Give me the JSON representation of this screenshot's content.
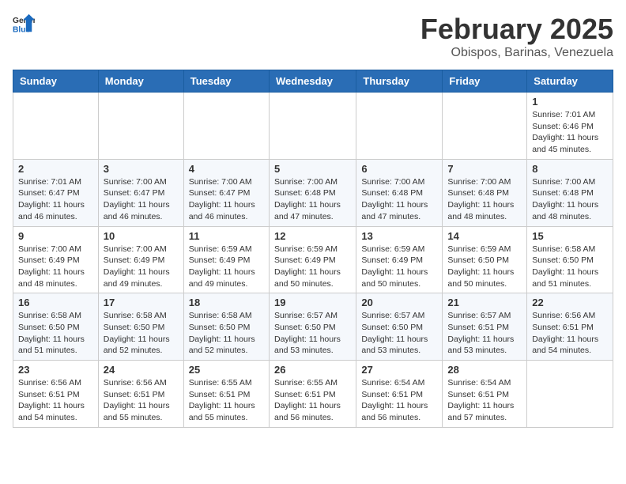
{
  "logo": {
    "general": "General",
    "blue": "Blue"
  },
  "header": {
    "month": "February 2025",
    "location": "Obispos, Barinas, Venezuela"
  },
  "weekdays": [
    "Sunday",
    "Monday",
    "Tuesday",
    "Wednesday",
    "Thursday",
    "Friday",
    "Saturday"
  ],
  "weeks": [
    [
      {
        "day": "",
        "sunrise": "",
        "sunset": "",
        "daylight": ""
      },
      {
        "day": "",
        "sunrise": "",
        "sunset": "",
        "daylight": ""
      },
      {
        "day": "",
        "sunrise": "",
        "sunset": "",
        "daylight": ""
      },
      {
        "day": "",
        "sunrise": "",
        "sunset": "",
        "daylight": ""
      },
      {
        "day": "",
        "sunrise": "",
        "sunset": "",
        "daylight": ""
      },
      {
        "day": "",
        "sunrise": "",
        "sunset": "",
        "daylight": ""
      },
      {
        "day": "1",
        "sunrise": "Sunrise: 7:01 AM",
        "sunset": "Sunset: 6:46 PM",
        "daylight": "Daylight: 11 hours and 45 minutes."
      }
    ],
    [
      {
        "day": "2",
        "sunrise": "Sunrise: 7:01 AM",
        "sunset": "Sunset: 6:47 PM",
        "daylight": "Daylight: 11 hours and 46 minutes."
      },
      {
        "day": "3",
        "sunrise": "Sunrise: 7:00 AM",
        "sunset": "Sunset: 6:47 PM",
        "daylight": "Daylight: 11 hours and 46 minutes."
      },
      {
        "day": "4",
        "sunrise": "Sunrise: 7:00 AM",
        "sunset": "Sunset: 6:47 PM",
        "daylight": "Daylight: 11 hours and 46 minutes."
      },
      {
        "day": "5",
        "sunrise": "Sunrise: 7:00 AM",
        "sunset": "Sunset: 6:48 PM",
        "daylight": "Daylight: 11 hours and 47 minutes."
      },
      {
        "day": "6",
        "sunrise": "Sunrise: 7:00 AM",
        "sunset": "Sunset: 6:48 PM",
        "daylight": "Daylight: 11 hours and 47 minutes."
      },
      {
        "day": "7",
        "sunrise": "Sunrise: 7:00 AM",
        "sunset": "Sunset: 6:48 PM",
        "daylight": "Daylight: 11 hours and 48 minutes."
      },
      {
        "day": "8",
        "sunrise": "Sunrise: 7:00 AM",
        "sunset": "Sunset: 6:48 PM",
        "daylight": "Daylight: 11 hours and 48 minutes."
      }
    ],
    [
      {
        "day": "9",
        "sunrise": "Sunrise: 7:00 AM",
        "sunset": "Sunset: 6:49 PM",
        "daylight": "Daylight: 11 hours and 48 minutes."
      },
      {
        "day": "10",
        "sunrise": "Sunrise: 7:00 AM",
        "sunset": "Sunset: 6:49 PM",
        "daylight": "Daylight: 11 hours and 49 minutes."
      },
      {
        "day": "11",
        "sunrise": "Sunrise: 6:59 AM",
        "sunset": "Sunset: 6:49 PM",
        "daylight": "Daylight: 11 hours and 49 minutes."
      },
      {
        "day": "12",
        "sunrise": "Sunrise: 6:59 AM",
        "sunset": "Sunset: 6:49 PM",
        "daylight": "Daylight: 11 hours and 50 minutes."
      },
      {
        "day": "13",
        "sunrise": "Sunrise: 6:59 AM",
        "sunset": "Sunset: 6:49 PM",
        "daylight": "Daylight: 11 hours and 50 minutes."
      },
      {
        "day": "14",
        "sunrise": "Sunrise: 6:59 AM",
        "sunset": "Sunset: 6:50 PM",
        "daylight": "Daylight: 11 hours and 50 minutes."
      },
      {
        "day": "15",
        "sunrise": "Sunrise: 6:58 AM",
        "sunset": "Sunset: 6:50 PM",
        "daylight": "Daylight: 11 hours and 51 minutes."
      }
    ],
    [
      {
        "day": "16",
        "sunrise": "Sunrise: 6:58 AM",
        "sunset": "Sunset: 6:50 PM",
        "daylight": "Daylight: 11 hours and 51 minutes."
      },
      {
        "day": "17",
        "sunrise": "Sunrise: 6:58 AM",
        "sunset": "Sunset: 6:50 PM",
        "daylight": "Daylight: 11 hours and 52 minutes."
      },
      {
        "day": "18",
        "sunrise": "Sunrise: 6:58 AM",
        "sunset": "Sunset: 6:50 PM",
        "daylight": "Daylight: 11 hours and 52 minutes."
      },
      {
        "day": "19",
        "sunrise": "Sunrise: 6:57 AM",
        "sunset": "Sunset: 6:50 PM",
        "daylight": "Daylight: 11 hours and 53 minutes."
      },
      {
        "day": "20",
        "sunrise": "Sunrise: 6:57 AM",
        "sunset": "Sunset: 6:50 PM",
        "daylight": "Daylight: 11 hours and 53 minutes."
      },
      {
        "day": "21",
        "sunrise": "Sunrise: 6:57 AM",
        "sunset": "Sunset: 6:51 PM",
        "daylight": "Daylight: 11 hours and 53 minutes."
      },
      {
        "day": "22",
        "sunrise": "Sunrise: 6:56 AM",
        "sunset": "Sunset: 6:51 PM",
        "daylight": "Daylight: 11 hours and 54 minutes."
      }
    ],
    [
      {
        "day": "23",
        "sunrise": "Sunrise: 6:56 AM",
        "sunset": "Sunset: 6:51 PM",
        "daylight": "Daylight: 11 hours and 54 minutes."
      },
      {
        "day": "24",
        "sunrise": "Sunrise: 6:56 AM",
        "sunset": "Sunset: 6:51 PM",
        "daylight": "Daylight: 11 hours and 55 minutes."
      },
      {
        "day": "25",
        "sunrise": "Sunrise: 6:55 AM",
        "sunset": "Sunset: 6:51 PM",
        "daylight": "Daylight: 11 hours and 55 minutes."
      },
      {
        "day": "26",
        "sunrise": "Sunrise: 6:55 AM",
        "sunset": "Sunset: 6:51 PM",
        "daylight": "Daylight: 11 hours and 56 minutes."
      },
      {
        "day": "27",
        "sunrise": "Sunrise: 6:54 AM",
        "sunset": "Sunset: 6:51 PM",
        "daylight": "Daylight: 11 hours and 56 minutes."
      },
      {
        "day": "28",
        "sunrise": "Sunrise: 6:54 AM",
        "sunset": "Sunset: 6:51 PM",
        "daylight": "Daylight: 11 hours and 57 minutes."
      },
      {
        "day": "",
        "sunrise": "",
        "sunset": "",
        "daylight": ""
      }
    ]
  ]
}
